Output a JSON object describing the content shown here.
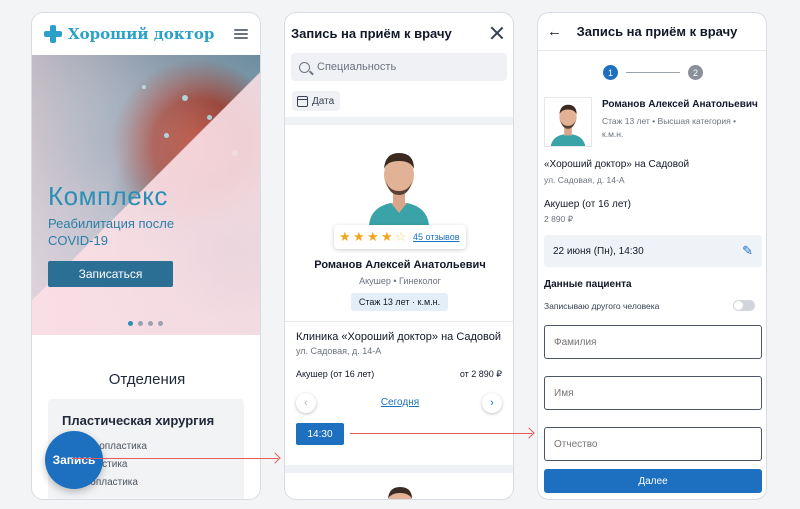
{
  "phone1": {
    "logo_text": "Хороший доктор",
    "hero_title": "Комплекс",
    "hero_subtitle": "Реабилитация после COVID-19",
    "hero_button": "Записаться",
    "carousel_active": 1,
    "carousel_count": 4,
    "section_title": "Отделения",
    "dept_title": "Пластическая хирургия",
    "dept_items": [
      "Блефаропластика",
      "Ринопластика",
      "Брахиопластика"
    ],
    "fab_label": "Запись"
  },
  "phone2": {
    "title": "Запись на приём к врачу",
    "search_placeholder": "Специальность",
    "date_chip": "Дата",
    "rating": 4,
    "reviews_link": "45 отзывов",
    "doctor_name": "Романов Алексей Анатольевич",
    "doctor_spec": "Акушер • Гинеколог",
    "experience": "Стаж 13 лет · к.м.н.",
    "clinic": "Клиника «Хороший доктор» на Садовой",
    "address": "ул. Садовая, д. 14-А",
    "service": "Акушер (от 16 лет)",
    "price": "от 2 890 ₽",
    "today_link": "Сегодня",
    "slot": "14:30"
  },
  "phone3": {
    "title": "Запись на приём к врачу",
    "step1": "1",
    "step2": "2",
    "doctor_name": "Романов Алексей Анатольевич",
    "doctor_meta": "Стаж 13 лет • Высшая категория • к.м.н.",
    "clinic": "«Хороший доктор» на Садовой",
    "address": "ул. Садовая, д. 14-А",
    "service": "Акушер (от 16 лет)",
    "price": "2 890 ₽",
    "datetime": "22 июня (Пн), 14:30",
    "patient_section": "Данные пациента",
    "toggle_label": "Записываю другого человека",
    "toggle_on": false,
    "field_surname": "Фамилия",
    "field_name": "Имя",
    "field_patronymic": "Отчество",
    "next_button": "Далее"
  },
  "colors": {
    "accent": "#1d6fbf",
    "brand": "#2ba0c9",
    "arrow": "#e85a5a",
    "star": "#f2a51a"
  }
}
